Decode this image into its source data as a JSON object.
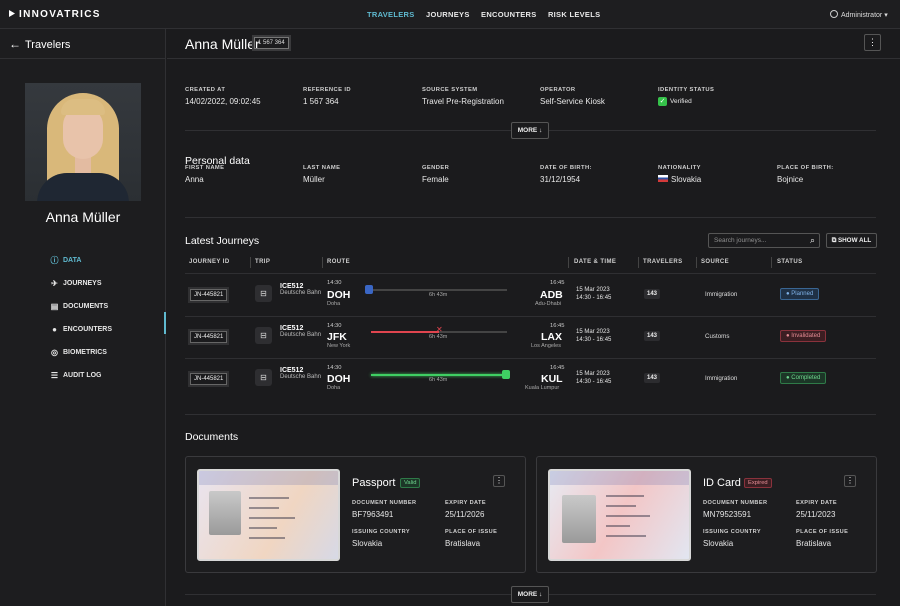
{
  "app": {
    "logo": "INNOVATRICS",
    "nav": [
      "TRAVELERS",
      "JOURNEYS",
      "ENCOUNTERS",
      "RISK LEVELS"
    ],
    "user": "Administrator"
  },
  "sidebar": {
    "back_title": "Travelers",
    "person_name": "Anna Müller",
    "items": [
      {
        "label": "DATA",
        "icon": "data-icon"
      },
      {
        "label": "JOURNEYS",
        "icon": "plane-icon"
      },
      {
        "label": "DOCUMENTS",
        "icon": "document-icon"
      },
      {
        "label": "ENCOUNTERS",
        "icon": "person-icon"
      },
      {
        "label": "BIOMETRICS",
        "icon": "fingerprint-icon"
      },
      {
        "label": "AUDIT LOG",
        "icon": "log-icon"
      }
    ]
  },
  "header": {
    "title": "Anna Müller",
    "badge": "1 567 364"
  },
  "meta": {
    "created_at": {
      "label": "CREATED AT",
      "value": "14/02/2022, 09:02:45"
    },
    "reference_id": {
      "label": "REFERENCE ID",
      "value": "1 567 364"
    },
    "source_system": {
      "label": "SOURCE SYSTEM",
      "value": "Travel Pre-Registration"
    },
    "operator": {
      "label": "OPERATOR",
      "value": "Self-Service Kiosk"
    },
    "identity_status": {
      "label": "IDENTITY STATUS",
      "value": "Verified"
    },
    "more": "MORE ↓"
  },
  "personal": {
    "title": "Personal data",
    "first_name": {
      "label": "FIRST NAME",
      "value": "Anna"
    },
    "last_name": {
      "label": "LAST NAME",
      "value": "Müller"
    },
    "gender": {
      "label": "GENDER",
      "value": "Female"
    },
    "dob": {
      "label": "DATE OF BIRTH:",
      "value": "31/12/1954"
    },
    "nationality": {
      "label": "NATIONALITY",
      "value": "Slovakia"
    },
    "pob": {
      "label": "PLACE OF BIRTH:",
      "value": "Bojnice"
    }
  },
  "journeys": {
    "title": "Latest Journeys",
    "search_placeholder": "Search journeys...",
    "show_all": "SHOW ALL",
    "columns": [
      "JOURNEY ID",
      "TRIP",
      "ROUTE",
      "DATE & TIME",
      "TRAVELERS",
      "SOURCE",
      "STATUS"
    ],
    "rows": [
      {
        "id": "JN-445821",
        "trip": "ICE512",
        "operator": "Deutsche Bahn",
        "dep_time": "14:30",
        "from": "DOH",
        "from_city": "Doha",
        "duration": "6h 43m",
        "arr_time": "16:45",
        "to": "ADB",
        "to_city": "Adu-Dhabi",
        "date": "15 Mar 2023",
        "time": "14:30 - 16:45",
        "travelers": "143",
        "source": "Immigration",
        "status": "Planned",
        "progress": 0
      },
      {
        "id": "JN-445821",
        "trip": "ICE512",
        "operator": "Deutsche Bahn",
        "dep_time": "14:30",
        "from": "JFK",
        "from_city": "New York",
        "duration": "6h 43m",
        "arr_time": "16:45",
        "to": "LAX",
        "to_city": "Los Angeles",
        "date": "15 Mar 2023",
        "time": "14:30 - 16:45",
        "travelers": "143",
        "source": "Customs",
        "status": "Invalidated",
        "progress": 0.5
      },
      {
        "id": "JN-445821",
        "trip": "ICE512",
        "operator": "Deutsche Bahn",
        "dep_time": "14:30",
        "from": "DOH",
        "from_city": "Doha",
        "duration": "6h 43m",
        "arr_time": "16:45",
        "to": "KUL",
        "to_city": "Kuala Lumpur",
        "date": "15 Mar 2023",
        "time": "14:30 - 16:45",
        "travelers": "143",
        "source": "Immigration",
        "status": "Completed",
        "progress": 1
      }
    ]
  },
  "documents": {
    "title": "Documents",
    "cards": [
      {
        "type": "Passport",
        "status": "Valid",
        "number_label": "DOCUMENT NUMBER",
        "number": "BF7963491",
        "expiry_label": "EXPIRY DATE",
        "expiry": "25/11/2026",
        "country_label": "ISSUING COUNTRY",
        "country": "Slovakia",
        "place_label": "PLACE OF ISSUE",
        "place": "Bratislava"
      },
      {
        "type": "ID Card",
        "status": "Expired",
        "number_label": "DOCUMENT NUMBER",
        "number": "MN79523591",
        "expiry_label": "EXPIRY DATE",
        "expiry": "25/11/2023",
        "country_label": "ISSUING COUNTRY",
        "country": "Slovakia",
        "place_label": "PLACE OF ISSUE",
        "place": "Bratislava"
      }
    ],
    "more": "MORE ↓"
  },
  "colors": {
    "accent": "#5fb9cf",
    "planned": "#7fb2e8",
    "invalidated": "#e0454f",
    "completed": "#3fcf63"
  }
}
